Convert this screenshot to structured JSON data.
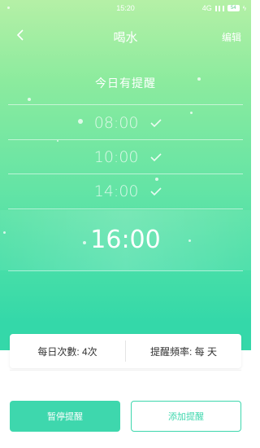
{
  "status_bar": {
    "time": "15:20",
    "network": "4G",
    "battery": "54"
  },
  "header": {
    "title": "喝水",
    "edit_label": "编辑"
  },
  "section_title": "今日有提醒",
  "reminders": [
    {
      "time": "08:00",
      "checked": true
    },
    {
      "time": "10:00",
      "checked": true
    },
    {
      "time": "14:00",
      "checked": true
    }
  ],
  "selected_time": "16:00",
  "info": {
    "daily_count": "每日次數: 4次",
    "frequency": "提醒頻率: 每 天"
  },
  "buttons": {
    "pause_label": "暂停提醒",
    "add_label": "添加提醒"
  },
  "colors": {
    "accent": "#3ed7ad"
  },
  "icons": {
    "back": "chevron-left-icon",
    "check": "check-icon"
  }
}
